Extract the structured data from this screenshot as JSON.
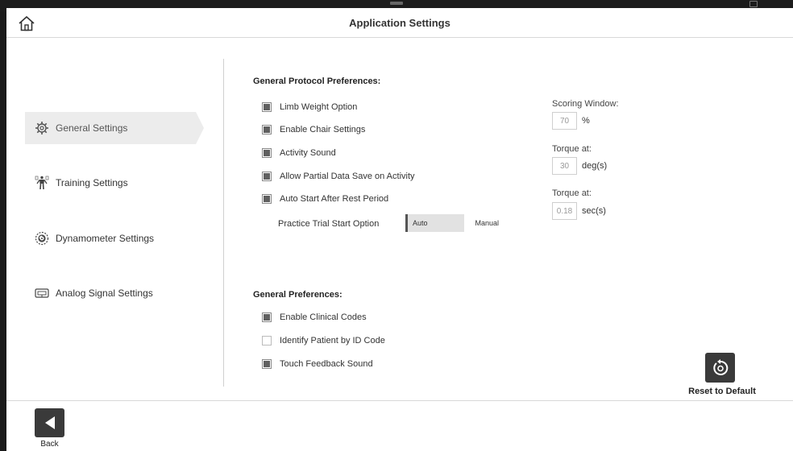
{
  "window": {
    "title": "Application Settings"
  },
  "sidebar": {
    "items": [
      {
        "label": "General Settings",
        "icon": "gear-icon",
        "active": true
      },
      {
        "label": "Training Settings",
        "icon": "body-figure-icon",
        "active": false
      },
      {
        "label": "Dynamometer Settings",
        "icon": "dynamometer-icon",
        "active": false
      },
      {
        "label": "Analog Signal Settings",
        "icon": "signal-device-icon",
        "active": false
      }
    ]
  },
  "protocol": {
    "heading": "General Protocol Preferences:",
    "options": [
      {
        "label": "Limb Weight Option",
        "checked": true
      },
      {
        "label": "Enable Chair Settings",
        "checked": true
      },
      {
        "label": "Activity Sound",
        "checked": true
      },
      {
        "label": "Allow Partial Data Save on Activity",
        "checked": true
      },
      {
        "label": "Auto Start After Rest Period",
        "checked": true
      }
    ],
    "practice_trial": {
      "label": "Practice Trial Start Option",
      "auto": "Auto",
      "manual": "Manual",
      "selected": "Auto"
    }
  },
  "fields": {
    "scoring": {
      "label": "Scoring Window:",
      "value": "70",
      "unit": "%"
    },
    "torque1": {
      "label": "Torque at:",
      "value": "30",
      "unit": "deg(s)"
    },
    "torque2": {
      "label": "Torque at:",
      "value": "0.18",
      "unit": "sec(s)"
    }
  },
  "general": {
    "heading": "General Preferences:",
    "options": [
      {
        "label": "Enable Clinical Codes",
        "checked": true
      },
      {
        "label": "Identify Patient by ID Code",
        "checked": false
      },
      {
        "label": "Touch Feedback Sound",
        "checked": true
      }
    ]
  },
  "actions": {
    "reset": "Reset to Default",
    "back": "Back"
  }
}
